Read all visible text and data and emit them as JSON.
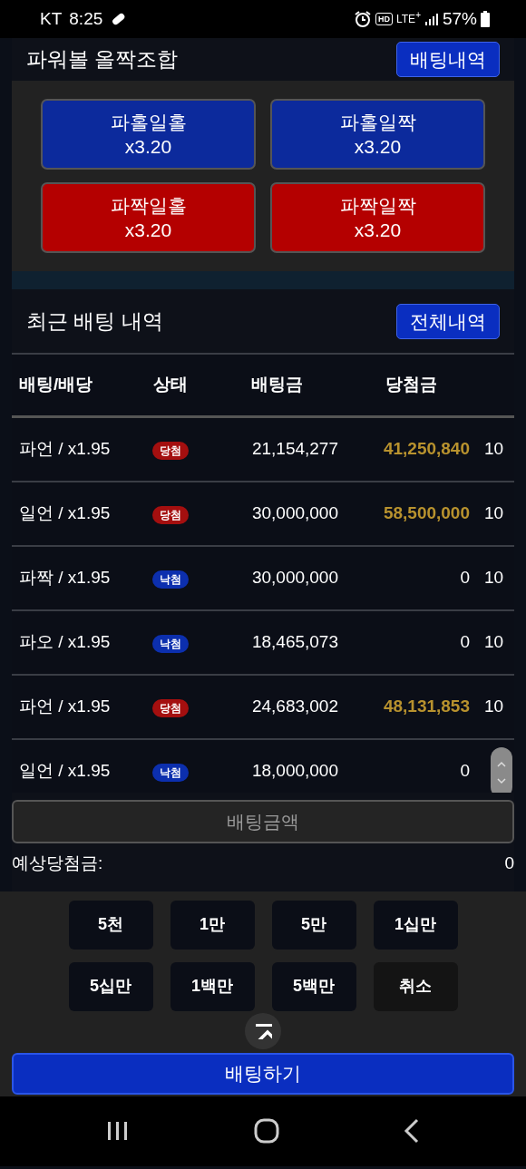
{
  "status_bar": {
    "carrier": "KT",
    "time": "8:25",
    "hd": "HD",
    "network": "LTE$^{+}$",
    "battery": "57%"
  },
  "combo": {
    "title": "파워볼 올짝조합",
    "history_button": "배팅내역",
    "options": [
      {
        "label": "파홀일홀",
        "odds": "x3.20",
        "kind": "blue"
      },
      {
        "label": "파홀일짝",
        "odds": "x3.20",
        "kind": "blue"
      },
      {
        "label": "파짝일홀",
        "odds": "x3.20",
        "kind": "red"
      },
      {
        "label": "파짝일짝",
        "odds": "x3.20",
        "kind": "red"
      }
    ]
  },
  "recent": {
    "title": "최근 배팅 내역",
    "all_button": "전체내역",
    "table": {
      "columns": [
        "배팅/배당",
        "상태",
        "배팅금",
        "당첨금"
      ],
      "rows": [
        {
          "bet": "파언 / x1.95",
          "status": "당첨",
          "kind": "win",
          "amount": "21,154,277",
          "payout": "41,250,840",
          "column_5": "10"
        },
        {
          "bet": "일언 / x1.95",
          "status": "당첨",
          "kind": "win",
          "amount": "30,000,000",
          "payout": "58,500,000",
          "column_5": "10"
        },
        {
          "bet": "파짝 / x1.95",
          "status": "낙첨",
          "kind": "lose",
          "amount": "30,000,000",
          "payout": "0",
          "column_5": "10"
        },
        {
          "bet": "파오 / x1.95",
          "status": "낙첨",
          "kind": "lose",
          "amount": "18,465,073",
          "payout": "0",
          "column_5": "10"
        },
        {
          "bet": "파언 / x1.95",
          "status": "당첨",
          "kind": "win",
          "amount": "24,683,002",
          "payout": "48,131,853",
          "column_5": "10"
        },
        {
          "bet": "일언 / x1.95",
          "status": "낙첨",
          "kind": "lose",
          "amount": "18,000,000",
          "payout": "0"
        }
      ]
    }
  },
  "bet_form": {
    "placeholder": "배팅금액",
    "expected_label": "예상당첨금:",
    "expected_value": "0",
    "amount_keys": [
      {
        "label": "5천",
        "kind": "amount"
      },
      {
        "label": "1만",
        "kind": "amount"
      },
      {
        "label": "5만",
        "kind": "amount"
      },
      {
        "label": "1십만",
        "kind": "amount"
      },
      {
        "label": "5십만",
        "kind": "amount"
      },
      {
        "label": "1백만",
        "kind": "amount"
      },
      {
        "label": "5백만",
        "kind": "amount"
      },
      {
        "label": "취소",
        "kind": "cancel"
      }
    ],
    "submit": "배팅하기"
  }
}
